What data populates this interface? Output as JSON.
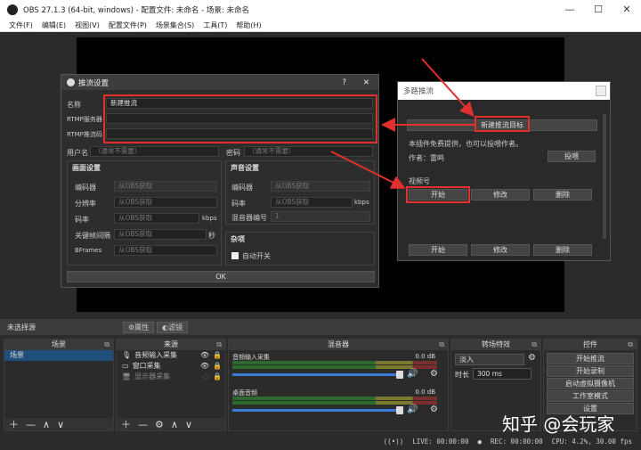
{
  "window": {
    "title": "OBS 27.1.3 (64-bit, windows) - 配置文件: 未命名 - 场景: 未命名"
  },
  "menu": [
    "文件(F)",
    "编辑(E)",
    "视图(V)",
    "配置文件(P)",
    "场景集合(S)",
    "工具(T)",
    "帮助(H)"
  ],
  "toolbar": {
    "no_source": "未选择源",
    "properties": "属性",
    "filters": "滤镜"
  },
  "docks": {
    "scenes": {
      "title": "场景",
      "items": [
        "场景"
      ]
    },
    "sources": {
      "title": "来源",
      "items": [
        "音频输入采集",
        "窗口采集",
        "显示器采集"
      ]
    },
    "mixer": {
      "title": "混音器",
      "ch1": "音频输入采集",
      "ch2": "桌面音频",
      "db1": "0.0 dB",
      "db2": "0.0 dB"
    },
    "transitions": {
      "title": "转场特效",
      "mode": "淡入",
      "duration_label": "时长",
      "duration": "300 ms"
    },
    "controls": {
      "title": "控件",
      "buttons": [
        "开始推流",
        "开始录制",
        "启动虚拟摄像机",
        "工作室模式",
        "设置"
      ]
    }
  },
  "status": {
    "live": "LIVE: 00:00:00",
    "rec": "REC: 00:00:00",
    "cpu": "CPU: 4.2%, 30.00 fps"
  },
  "stream_dialog": {
    "title": "推流设置",
    "name_label": "名称",
    "name_value": "新建推流",
    "server_label": "RTMP服务器",
    "key_label": "RTMP推流码",
    "user_label": "用户名",
    "user_placeholder": "（通常不需要）",
    "pass_label": "密码",
    "pass_placeholder": "（通常不需要）",
    "video_group": "画面设置",
    "audio_group": "声音设置",
    "encoder_label": "编码器",
    "encoder_value": "从OBS获取",
    "res_label": "分辨率",
    "res_value": "从OBS获取",
    "bitrate_label": "码率",
    "bitrate_value": "从OBS获取",
    "kbps": "kbps",
    "kf_label": "关键帧间隔",
    "kf_value": "从OBS获取",
    "sec": "秒",
    "bframes_label": "BFrames",
    "bframes_value": "从OBS获取",
    "a_encoder_label": "编码器",
    "a_encoder_value": "从OBS获取",
    "a_bitrate_label": "码率",
    "a_bitrate_value": "从OBS获取",
    "a_mixer_label": "混音器编号",
    "a_mixer_value": "1",
    "misc_group": "杂项",
    "auto_start": "自动开关",
    "ok": "OK"
  },
  "multi_dialog": {
    "title": "多路推流",
    "new_target": "新建推流目标",
    "info": "本插件免费提供，也可以投喂作者。",
    "author": "作者：雷鸣",
    "donate": "投喂",
    "target": "视频号",
    "start": "开始",
    "edit": "修改",
    "delete": "删除",
    "start2": "开始",
    "edit2": "修改",
    "delete2": "删除"
  },
  "watermark": "知乎 @会玩家"
}
